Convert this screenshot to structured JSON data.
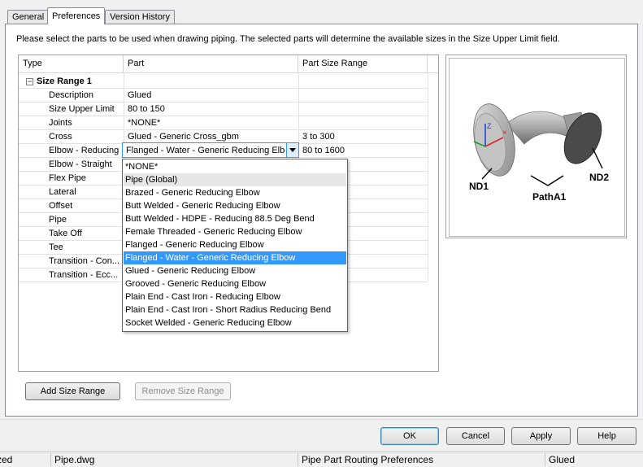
{
  "tabs": [
    {
      "label": "General"
    },
    {
      "label": "Preferences"
    },
    {
      "label": "Version History"
    }
  ],
  "instruction": "Please select the parts to be used when drawing piping. The selected parts will determine the available sizes in the Size Upper Limit field.",
  "grid": {
    "columns": [
      "Type",
      "Part",
      "Part Size Range"
    ],
    "group": {
      "expander": "−",
      "label": "Size Range 1"
    },
    "rows": [
      {
        "type": "Description",
        "part": "Glued",
        "range": ""
      },
      {
        "type": "Size Upper Limit",
        "part": "80 to 150",
        "range": ""
      },
      {
        "type": "Joints",
        "part": "*NONE*",
        "range": ""
      },
      {
        "type": "Cross",
        "part": "Glued - Generic Cross_gbm",
        "range": "3 to 300"
      },
      {
        "type": "Elbow - Reducing",
        "part": "Flanged - Water - Generic Reducing Elbow",
        "range": "80 to 1600"
      },
      {
        "type": "Elbow - Straight",
        "part": "",
        "range": ""
      },
      {
        "type": "Flex Pipe",
        "part": "",
        "range": ""
      },
      {
        "type": "Lateral",
        "part": "",
        "range": ""
      },
      {
        "type": "Offset",
        "part": "",
        "range": ""
      },
      {
        "type": "Pipe",
        "part": "",
        "range": ""
      },
      {
        "type": "Take Off",
        "part": "",
        "range": ""
      },
      {
        "type": "Tee",
        "part": "",
        "range": ""
      },
      {
        "type": "Transition - Con...",
        "part": "",
        "range": ""
      },
      {
        "type": "Transition - Ecc...",
        "part": "",
        "range": ""
      }
    ]
  },
  "combo": {
    "value": "Flanged - Water - Generic Reducing Elbow"
  },
  "dropdown": {
    "options": [
      "*NONE*",
      "Pipe (Global)",
      "Brazed - Generic Reducing Elbow",
      "Butt Welded - Generic Reducing Elbow",
      "Butt Welded - HDPE - Reducing 88.5 Deg Bend",
      "Female Threaded - Generic Reducing Elbow",
      "Flanged - Generic Reducing Elbow",
      "Flanged - Water - Generic Reducing Elbow",
      "Glued - Generic Reducing Elbow",
      "Grooved - Generic Reducing Elbow",
      "Plain End - Cast Iron - Reducing Elbow",
      "Plain End - Cast Iron - Short Radius Reducing Bend",
      "Socket Welded - Generic Reducing Elbow"
    ],
    "hover_index": 1,
    "selected_index": 7
  },
  "preview": {
    "labels": {
      "nd1": "ND1",
      "nd2": "ND2",
      "path": "PathA1"
    },
    "axis": {
      "z": "Z"
    }
  },
  "buttons": {
    "add_size_range": "Add Size Range",
    "remove_size_range": "Remove Size Range",
    "ok": "OK",
    "cancel": "Cancel",
    "apply": "Apply",
    "help": "Help"
  },
  "statusbar": {
    "cells": [
      "zed",
      "Pipe.dwg",
      "Pipe Part Routing Preferences",
      "Glued"
    ]
  },
  "colors": {
    "selection": "#3399ff",
    "focus_border": "#3399ff",
    "axis_x": "#e02020",
    "axis_y": "#20a020",
    "axis_z": "#2040e0"
  }
}
